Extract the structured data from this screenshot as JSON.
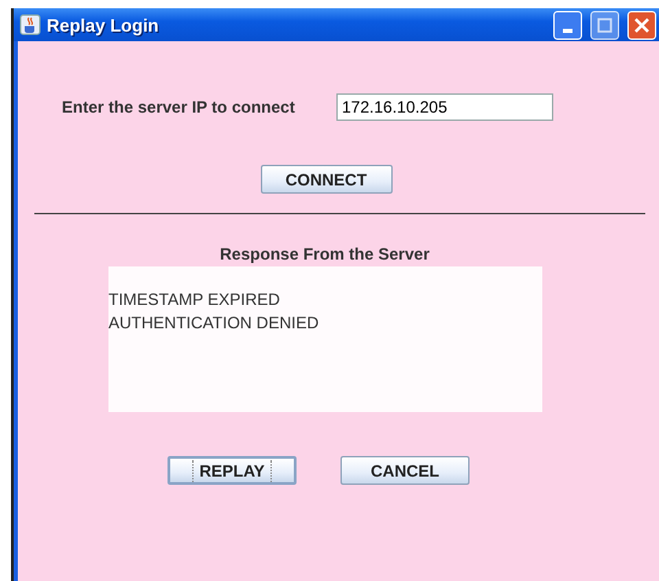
{
  "window": {
    "title": "Replay Login"
  },
  "server_ip": {
    "label": "Enter the server IP to connect",
    "value": "172.16.10.205"
  },
  "connect_button": {
    "label": "CONNECT",
    "focused": false
  },
  "response": {
    "heading": "Response From the Server",
    "lines": [
      "TIMESTAMP EXPIRED",
      "AUTHENTICATION DENIED"
    ]
  },
  "buttons": [
    {
      "label": "REPLAY",
      "focused": true
    },
    {
      "label": "CANCEL",
      "focused": false
    }
  ]
}
